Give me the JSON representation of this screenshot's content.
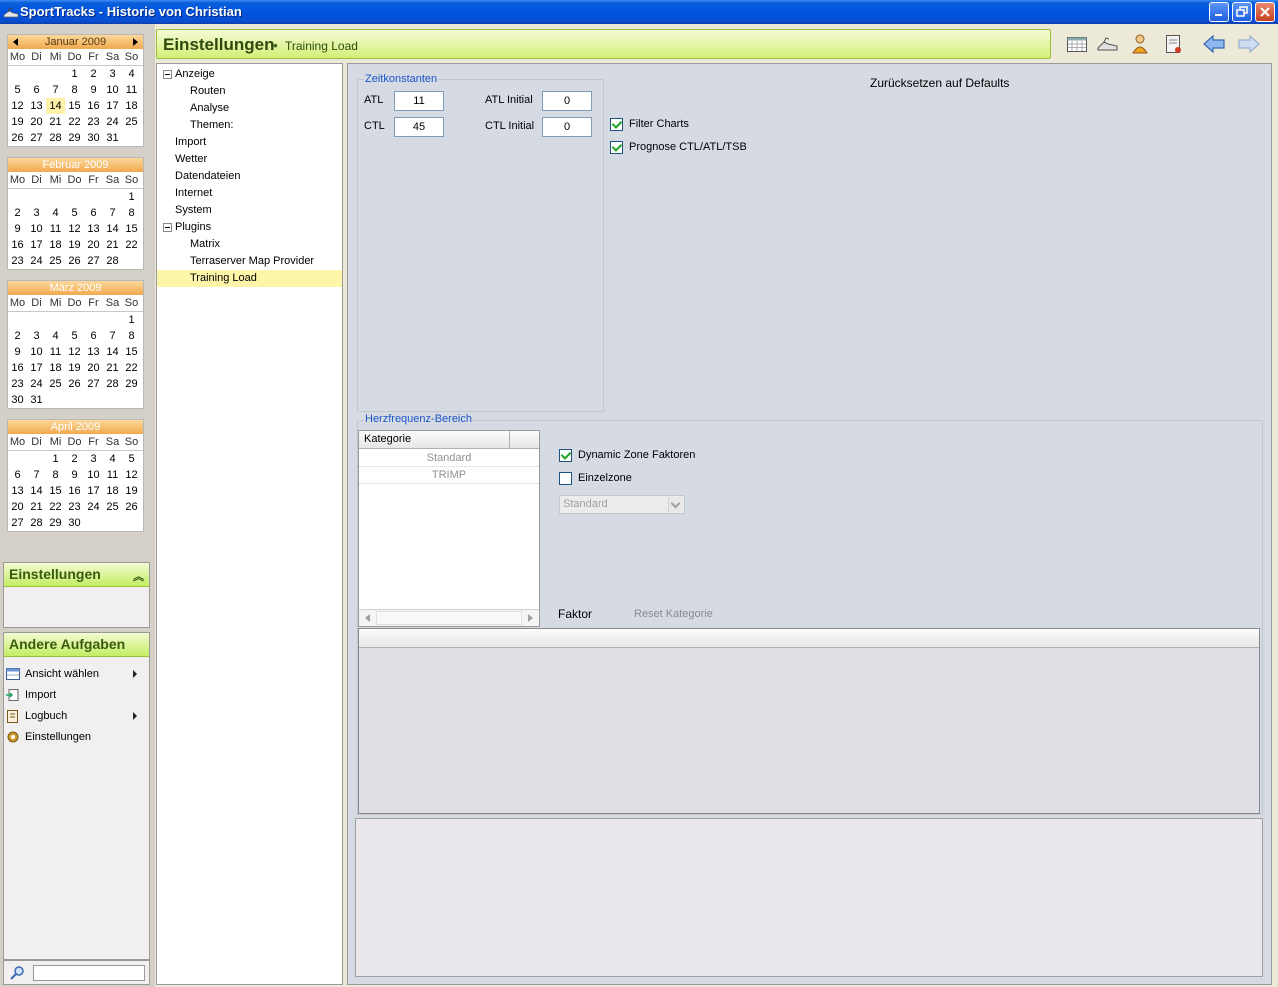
{
  "window": {
    "title": "SportTracks - Historie von Christian"
  },
  "calendars": [
    {
      "month": "Januar 2009",
      "days": [
        "Mo",
        "Di",
        "Mi",
        "Do",
        "Fr",
        "Sa",
        "So"
      ],
      "weeks": [
        [
          "",
          "",
          "",
          "1",
          "2",
          "3",
          "4"
        ],
        [
          "5",
          "6",
          "7",
          "8",
          "9",
          "10",
          "11"
        ],
        [
          "12",
          "13",
          "14",
          "15",
          "16",
          "17",
          "18"
        ],
        [
          "19",
          "20",
          "21",
          "22",
          "23",
          "24",
          "25"
        ],
        [
          "26",
          "27",
          "28",
          "29",
          "30",
          "31",
          ""
        ]
      ],
      "today": "14"
    },
    {
      "month": "Februar 2009",
      "days": [
        "Mo",
        "Di",
        "Mi",
        "Do",
        "Fr",
        "Sa",
        "So"
      ],
      "weeks": [
        [
          "",
          "",
          "",
          "",
          "",
          "",
          "1"
        ],
        [
          "2",
          "3",
          "4",
          "5",
          "6",
          "7",
          "8"
        ],
        [
          "9",
          "10",
          "11",
          "12",
          "13",
          "14",
          "15"
        ],
        [
          "16",
          "17",
          "18",
          "19",
          "20",
          "21",
          "22"
        ],
        [
          "23",
          "24",
          "25",
          "26",
          "27",
          "28",
          ""
        ]
      ]
    },
    {
      "month": "März 2009",
      "days": [
        "Mo",
        "Di",
        "Mi",
        "Do",
        "Fr",
        "Sa",
        "So"
      ],
      "weeks": [
        [
          "",
          "",
          "",
          "",
          "",
          "",
          "1"
        ],
        [
          "2",
          "3",
          "4",
          "5",
          "6",
          "7",
          "8"
        ],
        [
          "9",
          "10",
          "11",
          "12",
          "13",
          "14",
          "15"
        ],
        [
          "16",
          "17",
          "18",
          "19",
          "20",
          "21",
          "22"
        ],
        [
          "23",
          "24",
          "25",
          "26",
          "27",
          "28",
          "29"
        ],
        [
          "30",
          "31",
          "",
          "",
          "",
          "",
          ""
        ]
      ]
    },
    {
      "month": "April 2009",
      "days": [
        "Mo",
        "Di",
        "Mi",
        "Do",
        "Fr",
        "Sa",
        "So"
      ],
      "weeks": [
        [
          "",
          "",
          "1",
          "2",
          "3",
          "4",
          "5"
        ],
        [
          "6",
          "7",
          "8",
          "9",
          "10",
          "11",
          "12"
        ],
        [
          "13",
          "14",
          "15",
          "16",
          "17",
          "18",
          "19"
        ],
        [
          "20",
          "21",
          "22",
          "23",
          "24",
          "25",
          "26"
        ],
        [
          "27",
          "28",
          "29",
          "30",
          "",
          "",
          ""
        ]
      ]
    }
  ],
  "settings_panel": {
    "title": "Einstellungen"
  },
  "tasks": {
    "title": "Andere Aufgaben",
    "items": [
      {
        "label": "Ansicht wählen",
        "icon": "view-icon"
      },
      {
        "label": "Import",
        "icon": "import-icon"
      },
      {
        "label": "Logbuch",
        "icon": "logbook-icon"
      },
      {
        "label": "Einstellungen",
        "icon": "gear-icon"
      }
    ]
  },
  "search": {
    "value": ""
  },
  "header": {
    "title": "Einstellungen",
    "separator": "•",
    "subtitle": "Training Load"
  },
  "toolbar": {
    "icons": [
      "calendar-icon",
      "shoe-icon",
      "athlete-icon",
      "logbook-icon",
      "back-arrow-icon",
      "forward-arrow-icon"
    ]
  },
  "tree": [
    {
      "label": "Anzeige",
      "level": 0,
      "expander": true
    },
    {
      "label": "Routen",
      "level": 1
    },
    {
      "label": "Analyse",
      "level": 1
    },
    {
      "label": "Themen:",
      "level": 1
    },
    {
      "label": "Import",
      "level": 0
    },
    {
      "label": "Wetter",
      "level": 0
    },
    {
      "label": "Datendateien",
      "level": 0
    },
    {
      "label": "Internet",
      "level": 0
    },
    {
      "label": "System",
      "level": 0
    },
    {
      "label": "Plugins",
      "level": 0,
      "expander": true
    },
    {
      "label": "Matrix",
      "level": 1
    },
    {
      "label": "Terraserver Map Provider",
      "level": 1
    },
    {
      "label": "Training Load",
      "level": 1,
      "selected": true
    }
  ],
  "zeitkonstanten": {
    "group_label": "Zeitkonstanten",
    "atl_label": "ATL",
    "atl_value": "11",
    "ctl_label": "CTL",
    "ctl_value": "45",
    "atl_initial_label": "ATL Initial",
    "atl_initial_value": "0",
    "ctl_initial_label": "CTL Initial",
    "ctl_initial_value": "0"
  },
  "reset_defaults": "Zurücksetzen auf Defaults",
  "filter_charts": {
    "label": "Filter Charts",
    "checked": true
  },
  "prognose": {
    "label": "Prognose CTL/ATL/TSB",
    "checked": true
  },
  "herzfrequenz": {
    "group_label": "Herzfrequenz-Bereich",
    "column_header": "Kategorie",
    "rows": [
      "Standard",
      "TRIMP"
    ],
    "dynamic_zone": {
      "label": "Dynamic Zone Faktoren",
      "checked": true
    },
    "einzelzone": {
      "label": "Einzelzone",
      "checked": false
    },
    "zone_select": "Standard",
    "faktor_label": "Faktor",
    "reset_kategorie": "Reset Kategorie"
  }
}
